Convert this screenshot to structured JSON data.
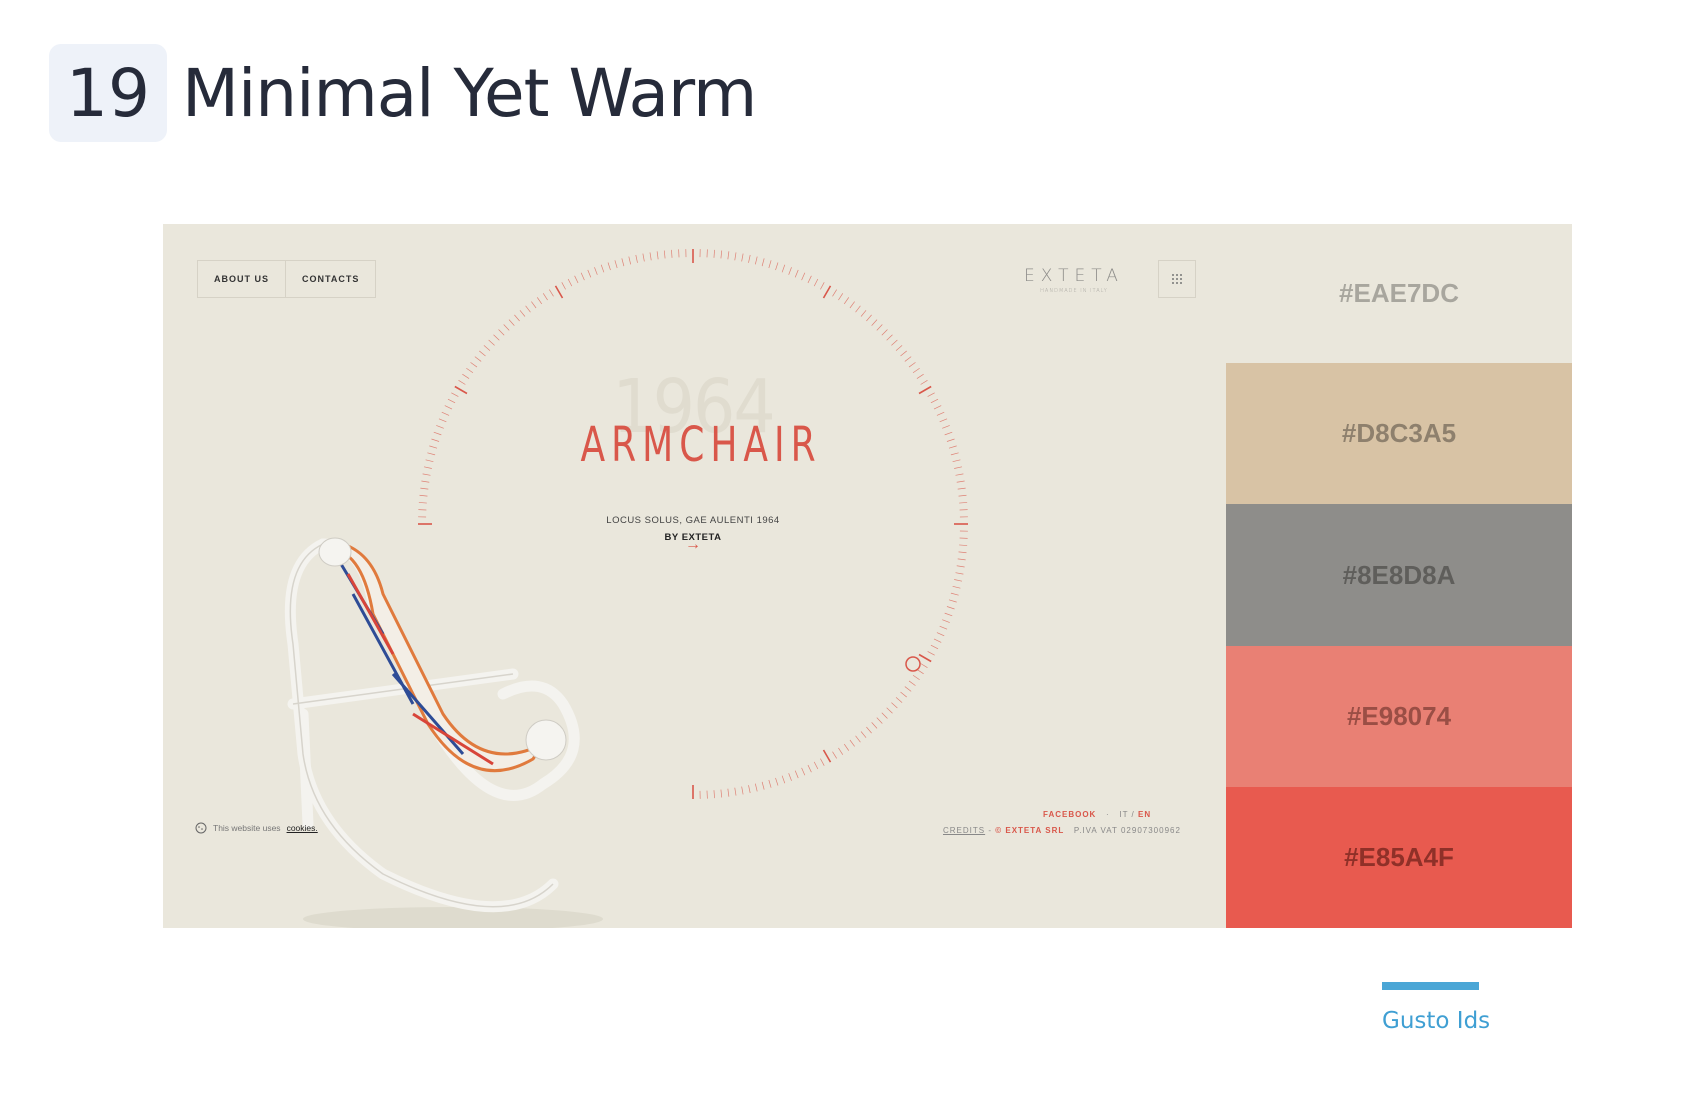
{
  "header": {
    "number": "19",
    "title": "Minimal Yet Warm"
  },
  "site": {
    "nav": [
      "ABOUT US",
      "CONTACTS"
    ],
    "logo": "EXTETA",
    "logo_sub": "HANDMADE IN ITALY",
    "year": "1964",
    "product": "ARMCHAIR",
    "subtitle_line1": "LOCUS SOLUS, GAE AULENTI 1964",
    "subtitle_line2": "BY EXTETA",
    "arrow": "→",
    "cookies_text": "This website uses",
    "cookies_link": "cookies.",
    "footer": {
      "facebook": "FACEBOOK",
      "lang_sep": "·",
      "lang_it": "IT /",
      "lang_en": "EN",
      "credits": "CREDITS",
      "dash": " - ",
      "copyright": "© EXTETA SRL",
      "vat": "P.IVA VAT 02907300962"
    }
  },
  "palette": [
    {
      "hex": "#EAE7DC",
      "color": "#EAE7DC",
      "text_color": "#a8a69e"
    },
    {
      "hex": "#D8C3A5",
      "color": "#D8C3A5",
      "text_color": "#8e806d"
    },
    {
      "hex": "#8E8D8A",
      "color": "#8E8D8A",
      "text_color": "#5f5e5b"
    },
    {
      "hex": "#E98074",
      "color": "#E98074",
      "text_color": "#9a4e45"
    },
    {
      "hex": "#E85A4F",
      "color": "#E85A4F",
      "text_color": "#8f3028"
    }
  ],
  "credit": "Gusto Ids",
  "colors": {
    "accent": "#D9574A",
    "credit_blue": "#4AA6D6"
  }
}
